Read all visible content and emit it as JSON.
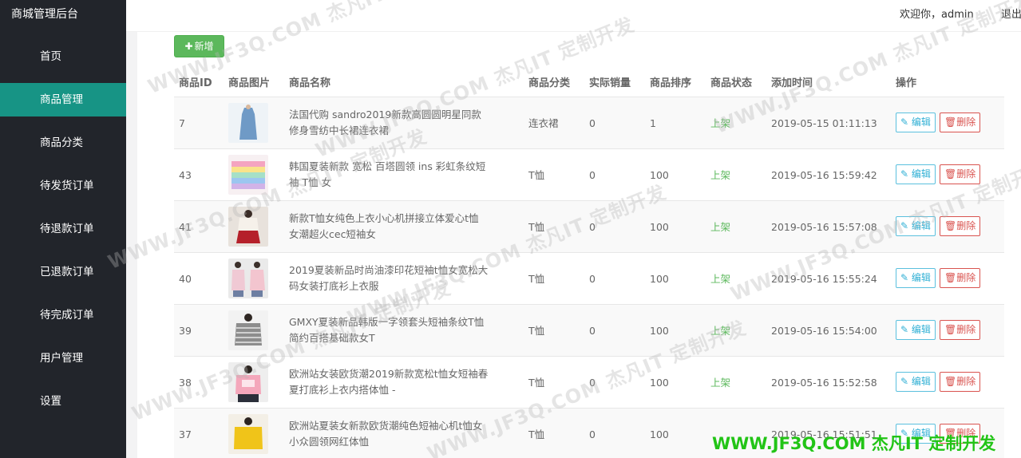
{
  "app": {
    "title": "商城管理后台"
  },
  "header": {
    "welcome": "欢迎你，admin",
    "logout": "退出"
  },
  "sidebar": {
    "items": [
      {
        "label": "首页",
        "active": false
      },
      {
        "label": "商品管理",
        "active": true
      },
      {
        "label": "商品分类",
        "active": false
      },
      {
        "label": "待发货订单",
        "active": false
      },
      {
        "label": "待退款订单",
        "active": false
      },
      {
        "label": "已退款订单",
        "active": false
      },
      {
        "label": "待完成订单",
        "active": false
      },
      {
        "label": "用户管理",
        "active": false
      },
      {
        "label": "设置",
        "active": false
      }
    ]
  },
  "toolbar": {
    "add_label": "新增",
    "add_icon": "plus-icon"
  },
  "table": {
    "headers": [
      "商品ID",
      "商品图片",
      "商品名称",
      "商品分类",
      "实际销量",
      "商品排序",
      "商品状态",
      "添加时间",
      "操作"
    ],
    "edit_label": "编辑",
    "delete_label": "删除",
    "rows": [
      {
        "id": "7",
        "name": "法国代购 sandro2019新款高圆圆明星同款修身雪纺中长裙连衣裙",
        "category": "连衣裙",
        "sales": "0",
        "sort": "1",
        "status": "上架",
        "added": "2019-05-15 01:11:13"
      },
      {
        "id": "43",
        "name": "韩国夏装新款 宽松 百塔圆领 ins 彩虹条纹短袖 T恤 女",
        "category": "T恤",
        "sales": "0",
        "sort": "100",
        "status": "上架",
        "added": "2019-05-16 15:59:42"
      },
      {
        "id": "41",
        "name": "新款T恤女纯色上衣小心机拼接立体爱心t恤女潮超火cec短袖女",
        "category": "T恤",
        "sales": "0",
        "sort": "100",
        "status": "上架",
        "added": "2019-05-16 15:57:08"
      },
      {
        "id": "40",
        "name": "2019夏装新品时尚油漆印花短袖t恤女宽松大码女装打底衫上衣服",
        "category": "T恤",
        "sales": "0",
        "sort": "100",
        "status": "上架",
        "added": "2019-05-16 15:55:24"
      },
      {
        "id": "39",
        "name": "GMXY夏装新品韩版一字领套头短袖条纹T恤简约百搭基础款女T",
        "category": "T恤",
        "sales": "0",
        "sort": "100",
        "status": "上架",
        "added": "2019-05-16 15:54:00"
      },
      {
        "id": "38",
        "name": "欧洲站女装欧货潮2019新款宽松t恤女短袖春夏打底衫上衣内搭体恤 -",
        "category": "T恤",
        "sales": "0",
        "sort": "100",
        "status": "上架",
        "added": "2019-05-16 15:52:58"
      },
      {
        "id": "37",
        "name": "欧洲站夏装女新款欧货潮纯色短袖心机t恤女小众圆领网红体恤",
        "category": "T恤",
        "sales": "0",
        "sort": "100",
        "status": "",
        "added": "2019-05-16 15:51:51"
      }
    ]
  },
  "watermark": {
    "text": "WWW.JF3Q.COM 杰凡IT 定制开发",
    "color": "#22c416"
  }
}
